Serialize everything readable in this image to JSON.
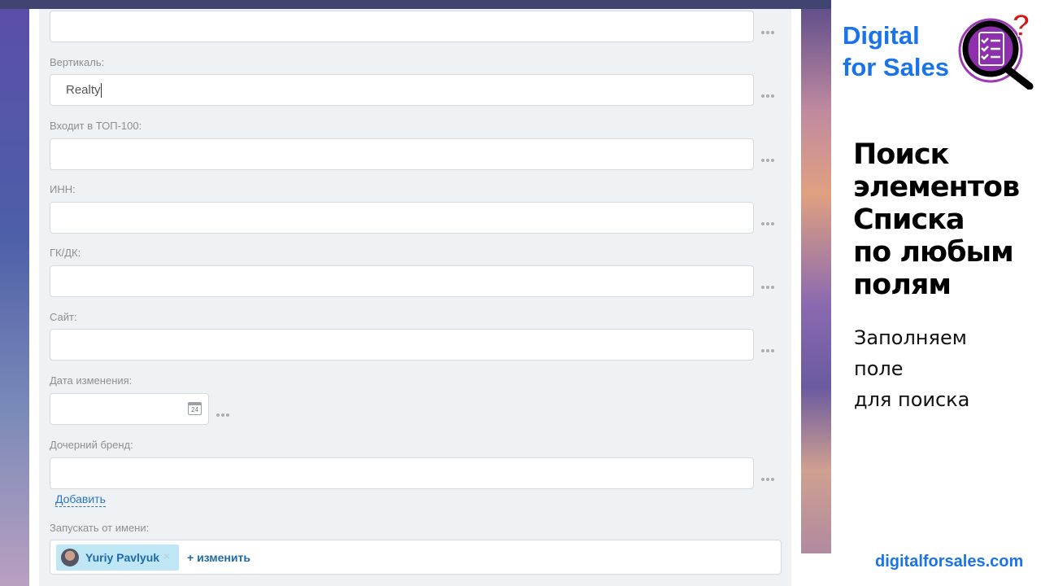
{
  "form": {
    "fields": [
      {
        "label": "",
        "value": ""
      },
      {
        "label": "Вертикаль:",
        "value": "Realty"
      },
      {
        "label": "Входит в ТОП-100:",
        "value": ""
      },
      {
        "label": "ИНН:",
        "value": ""
      },
      {
        "label": "ГК/ДК:",
        "value": ""
      },
      {
        "label": "Сайт:",
        "value": ""
      }
    ],
    "date_field": {
      "label": "Дата изменения:",
      "value": "",
      "calendar_day": "24"
    },
    "child_brand": {
      "label": "Дочерний бренд:",
      "value": "",
      "add_link": "Добавить"
    },
    "run_as": {
      "label": "Запускать от имени:",
      "user": "Yuriy Pavlyuk",
      "remove": "×",
      "change": "+ изменить"
    }
  },
  "branding": {
    "brand_line1": "Digital",
    "brand_line2": "for Sales",
    "headline": [
      "Поиск",
      "элементов",
      "Списка",
      "по любым",
      "полям"
    ],
    "subtitle": [
      "Заполняем",
      "поле",
      "для поиска"
    ],
    "website": "digitalforsales.com",
    "brand_color": "#1a73e8",
    "logo_icon": "magnifier-checklist-question-icon"
  }
}
